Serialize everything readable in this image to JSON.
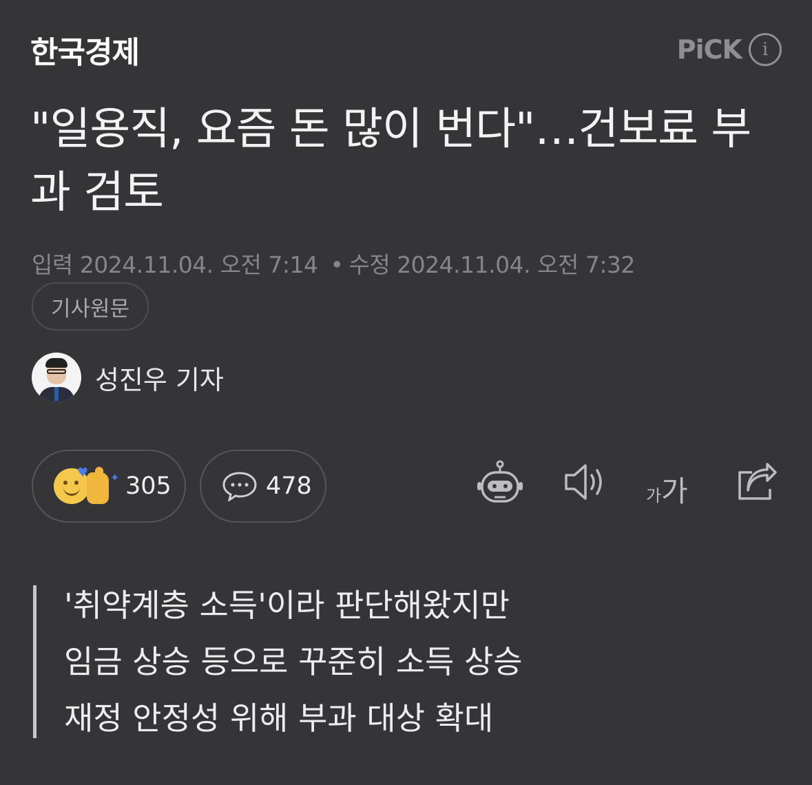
{
  "press": {
    "name": "한국경제"
  },
  "pick": {
    "label": "PiCK",
    "info_icon": "i"
  },
  "article": {
    "headline": "\"일용직, 요즘 돈 많이 번다\"…건보료 부과 검토",
    "input_label": "입력",
    "input_date": "2024.11.04. 오전 7:14",
    "separator": "•",
    "modified_label": "수정",
    "modified_date": "2024.11.04. 오전 7:32",
    "original_button": "기사원문",
    "reporter": "성진우 기자"
  },
  "reactions": {
    "like_count": "305",
    "comment_count": "478"
  },
  "tools": {
    "font_small": "가",
    "font_big": "가"
  },
  "icons": [
    "info-icon",
    "reaction-emoji-icon",
    "comment-bubble-icon",
    "summary-bot-icon",
    "sound-icon",
    "font-size-icon",
    "share-icon"
  ],
  "summary": {
    "lines": [
      "'취약계층 소득'이라 판단해왔지만",
      "임금 상승 등으로 꾸준히 소득 상승",
      "재정 안정성 위해 부과 대상 확대"
    ]
  }
}
